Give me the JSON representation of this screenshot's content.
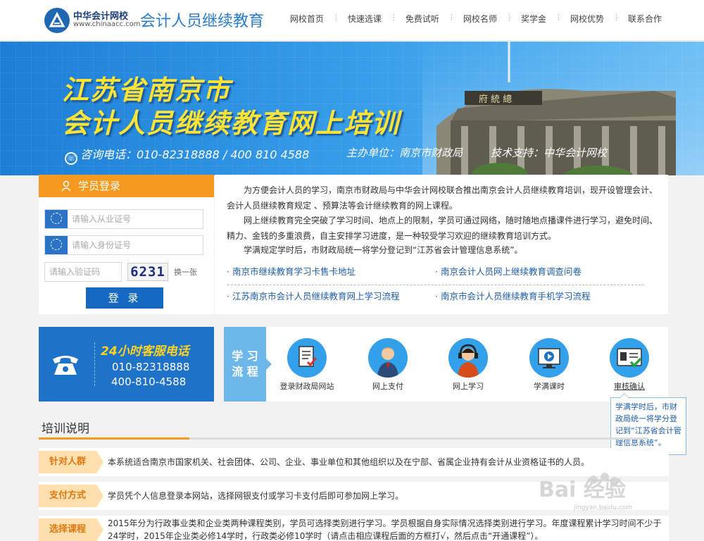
{
  "header": {
    "logo_name": "中华会计网校",
    "logo_url": "www.chinaacc.com",
    "site_title": "会计人员继续教育",
    "nav": [
      "网校首页",
      "快速选课",
      "免费试听",
      "网校名师",
      "奖学金",
      "网校优势",
      "联系合作"
    ]
  },
  "banner": {
    "title1": "江苏省南京市",
    "title2": "会计人员继续教育网上培训",
    "phone": "咨询电话：010-82318888 / 400 810 4588",
    "org": "主办单位：南京市财政局",
    "tech": "技术支持：中华会计网校",
    "plaque": "府 統 總"
  },
  "login": {
    "title": "学员登录",
    "cert_placeholder": "请输入从业证号",
    "id_placeholder": "请输入身份证号",
    "captcha_placeholder": "请输入验证码",
    "captcha": "6231",
    "refresh": "换一张",
    "submit": "登 录"
  },
  "intro": {
    "p1": "为方便会计人员的学习，南京市财政局与中华会计网校联合推出南京会计人员继续教育培训，现开设管理会计、会计人员继续教育规定 、预算法等会计继续教育的网上课程。",
    "p2": "网上继续教育完全突破了学习时间、地点上的限制，学员可通过网络，随时随地点播课件进行学习，避免时间、精力、金钱的多重浪费，自主安排学习进度，是一种较受学习欢迎的继续教育培训方式。",
    "p3": "学满规定学时后，市财政局统一将学分登记到“江苏省会计管理信息系统”。",
    "links": [
      "· 南京市继续教育学习卡售卡地址",
      "· 南京会计人员网上继续教育调查问卷",
      "· 江苏南京市会计人员继续教育网上学习流程",
      "· 南京市会计人员继续教育手机学习流程"
    ]
  },
  "hotline": {
    "title": "24小时客服电话",
    "n1": "010-82318888",
    "n2": "400-810-4588"
  },
  "process": {
    "label1": "学 习",
    "label2": "流 程",
    "steps": [
      "登录财政局网站",
      "网上支付",
      "网上学习",
      "学满课时",
      "审核确认"
    ],
    "tip": "学满学时后，市财政局统一将学分登记到“江苏省会计管理信息系统”。"
  },
  "training": {
    "title": "培训说明",
    "rows": [
      {
        "tag": "针对人群",
        "text": "本系统适合南京市国家机关、社会团体、公司、企业、事业单位和其他组织以及在宁部、省属企业持有会计从业资格证书的人员。"
      },
      {
        "tag": "支付方式",
        "text": "学员凭个人信息登录本网站，选择网银支付或学习卡支付后即可参加网上学习。"
      },
      {
        "tag": "选择课程",
        "text": "2015年分为行政事业类和企业类两种课程类别，学员可选择类别进行学习。学员根据自身实际情况选择类别进行学习。年度课程累计学习时间不少于24学时，2015年企业类必修14学时，行政类必修10学时（请点击相应课程后面的方框打√，然后点击“开通课程”）。"
      }
    ]
  },
  "watermark": {
    "text": "Bai 经验",
    "sub": "jingyan.baidu.com"
  },
  "colors": {
    "orange": "#f39a1f",
    "blue": "#1e73c9",
    "light_blue": "#33a0ea",
    "link": "#1f5ea8"
  }
}
